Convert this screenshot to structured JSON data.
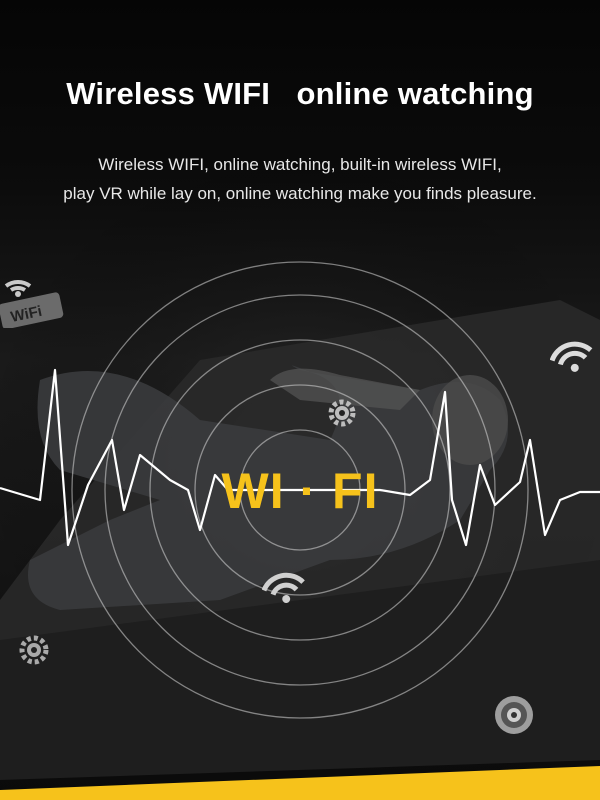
{
  "heading": {
    "title": "Wireless WIFI   online watching",
    "description_line1": "Wireless WIFI, online watching, built-in wireless WIFI,",
    "description_line2": "play VR while lay on, online watching make you finds pleasure."
  },
  "center_label": "WI · FI",
  "badge_text": "WiFi",
  "icons": [
    "wifi-icon",
    "gear-icon",
    "speaker-icon"
  ],
  "colors": {
    "accent_yellow": "#f6c21b",
    "background": "#0b0b0b",
    "text_white": "#ffffff"
  }
}
